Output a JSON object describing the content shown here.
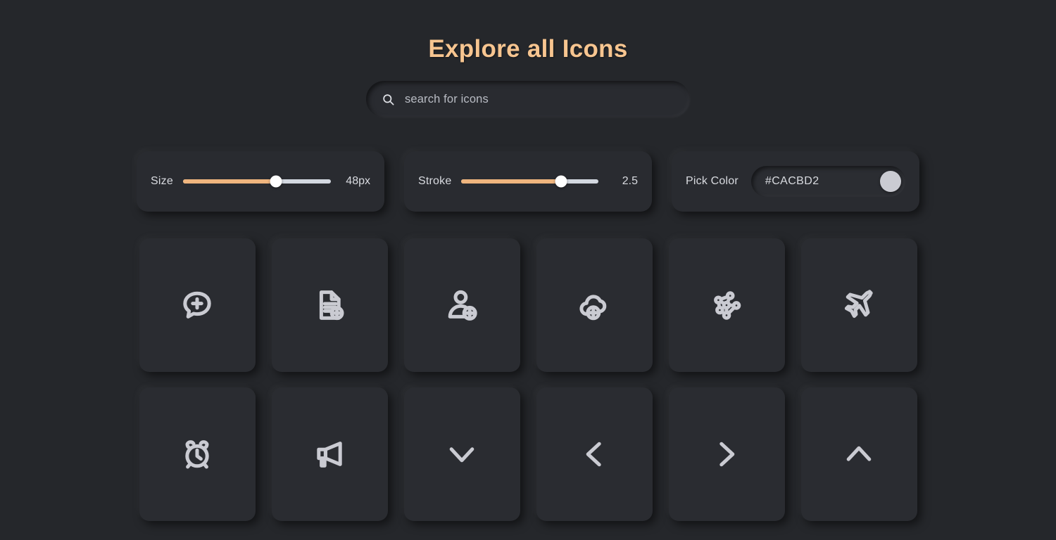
{
  "header": {
    "title": "Explore all Icons"
  },
  "search": {
    "icon": "search-icon",
    "placeholder": "search for icons",
    "value": ""
  },
  "controls": {
    "size": {
      "label": "Size",
      "value_text": "48px",
      "value": 48,
      "min": 16,
      "max": 64,
      "percent": 63
    },
    "stroke": {
      "label": "Stroke",
      "value_text": "2.5",
      "value": 2.5,
      "min": 0.5,
      "max": 3.2,
      "percent": 73
    },
    "color": {
      "label": "Pick Color",
      "value": "#CACBD2",
      "swatch": "#CACBD2"
    }
  },
  "palette": {
    "background": "#25272B",
    "panel": "#292B30",
    "card": "#2A2C31",
    "accent": "#F7C590",
    "slider_fill": "#EFB57E",
    "slider_track": "#D3D8E0",
    "icon_stroke": "#CACBD2",
    "text": "#D6D8DD"
  },
  "icons": [
    {
      "name": "comment-add-icon",
      "label": "comment add"
    },
    {
      "name": "file-add-icon",
      "label": "file add"
    },
    {
      "name": "user-add-icon",
      "label": "user add"
    },
    {
      "name": "cloud-add-icon",
      "label": "cloud add"
    },
    {
      "name": "network-nodes-icon",
      "label": "network nodes"
    },
    {
      "name": "airplane-icon",
      "label": "airplane"
    },
    {
      "name": "alarm-clock-icon",
      "label": "alarm clock"
    },
    {
      "name": "megaphone-icon",
      "label": "megaphone"
    },
    {
      "name": "chevron-down-icon",
      "label": "chevron down"
    },
    {
      "name": "chevron-left-icon",
      "label": "chevron left"
    },
    {
      "name": "chevron-right-icon",
      "label": "chevron right"
    },
    {
      "name": "chevron-up-icon",
      "label": "chevron up"
    }
  ]
}
